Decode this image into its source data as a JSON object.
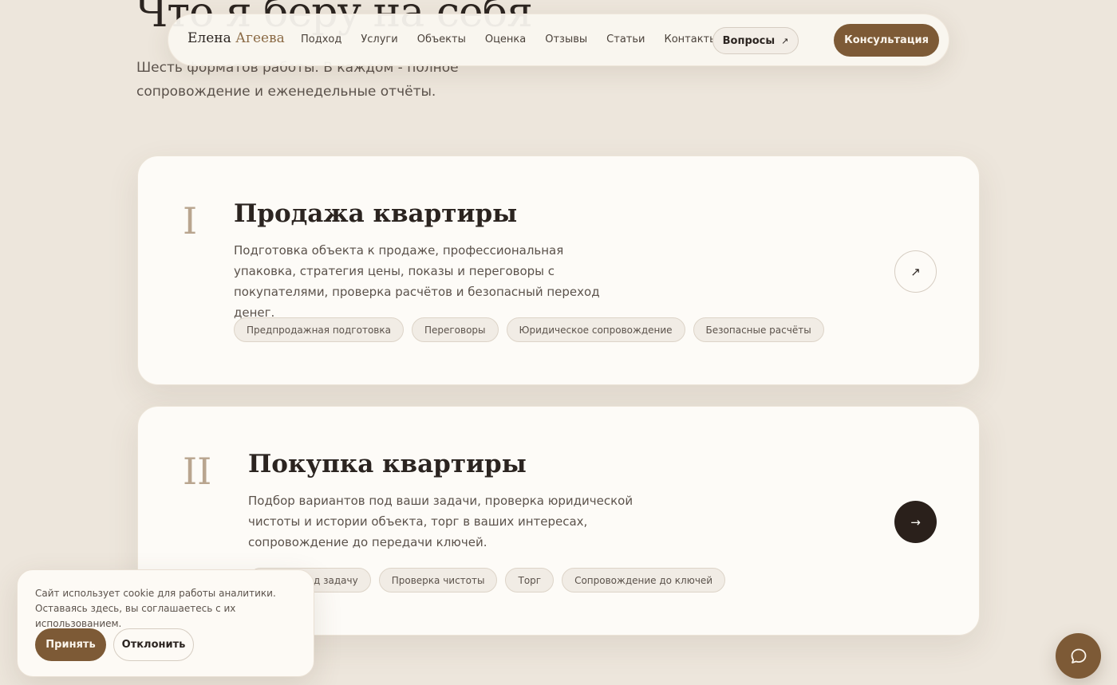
{
  "section": {
    "title": "Что я беру на себя",
    "subtitle": "Шесть форматов работы. В каждом - полное сопровождение и еженедельные отчёты."
  },
  "nav": {
    "logo_first": "Елена",
    "logo_last": "Агеева",
    "links": [
      "Подход",
      "Услуги",
      "Объекты",
      "Оценка",
      "Отзывы",
      "Статьи",
      "Контакты"
    ],
    "faq_label": "Вопросы",
    "faq_icon": "arrow-up-right-icon",
    "consult_label": "Консультация"
  },
  "services": [
    {
      "numeral": "I",
      "title": "Продажа квартиры",
      "description": "Подготовка объекта к продаже, профессиональная упаковка, стратегия цены, показы и переговоры с покупателями, проверка расчётов и безопасный переход денег.",
      "tags": [
        "Предпродажная подготовка",
        "Переговоры",
        "Юридическое сопровождение",
        "Безопасные расчёты"
      ],
      "arrow_icon": "arrow-up-right-icon"
    },
    {
      "numeral": "II",
      "title": "Покупка квартиры",
      "description": "Подбор вариантов под ваши задачи, проверка юридической чистоты и истории объекта, торг в ваших интересах, сопровождение до передачи ключей.",
      "tags": [
        "Подбор под задачу",
        "Проверка чистоты",
        "Торг",
        "Сопровождение до ключей"
      ],
      "arrow_icon": "arrow-right-icon"
    }
  ],
  "cookie": {
    "text": "Сайт использует cookie для работы аналитики. Оставаясь здесь, вы соглашаетесь с их использованием.",
    "accept_label": "Принять",
    "decline_label": "Отклонить"
  },
  "chat": {
    "icon": "chat-bubble-icon"
  },
  "colors": {
    "background": "#ede6dc",
    "card": "#fdfbf7",
    "accent": "#7d5a36",
    "dark": "#2a201b",
    "numeral": "#b9a58f"
  }
}
